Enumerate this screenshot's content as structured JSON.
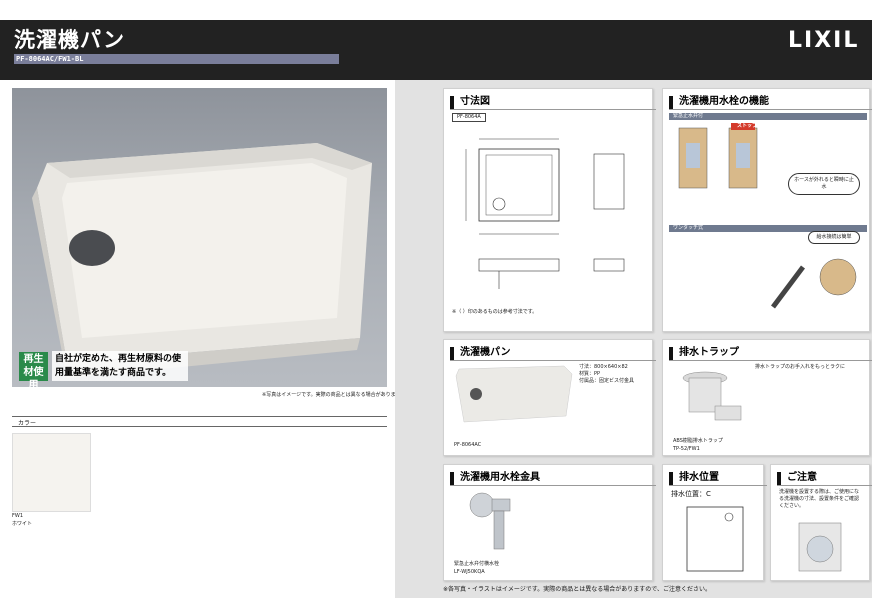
{
  "header": {
    "title": "洗濯機パン",
    "product_code": "PF-8064AC/FW1-BL",
    "brand": "LIXIL"
  },
  "photo": {
    "note": "※写真はイメージです。実際の商品とは異なる場合があります。"
  },
  "badge": {
    "label": "再生材使用",
    "text": "自社が定めた、再生材原料の使用量基準を満たす商品です。"
  },
  "color_section": {
    "heading": "カラー",
    "swatch_code": "FW1",
    "swatch_name": "ホワイト"
  },
  "panels": {
    "dimensions": {
      "title": "寸法図",
      "model": "PF-8064A",
      "footnote": "※（ ）印のあるものは参考寸法です。"
    },
    "faucet_function": {
      "title": "洗濯機用水栓の機能",
      "sub1": "緊急止水弁付",
      "sub2": "ワンタッチ式",
      "stop_label": "ストップ",
      "callout1": "ホースが外れると瞬時に止水",
      "callout2": "給水接続は簡単"
    },
    "pan": {
      "title": "洗濯機パン",
      "size": "寸法：800×640×82",
      "material": "材質：PP",
      "accessories": "付属品：固定ビス付金具",
      "caption": "PF-8064AC"
    },
    "trap": {
      "title": "排水トラップ",
      "text": "排水トラップのお手入れをもっとラクに",
      "caption": "ABS樹脂排水トラップ",
      "model": "TP-52/FW1"
    },
    "faucet_fitting": {
      "title": "洗濯機用水栓金具",
      "caption": "緊急止水弁付横水栓",
      "model": "LF-WJ50KQA"
    },
    "drain_position": {
      "title": "排水位置",
      "value": "排水位置：C"
    },
    "caution": {
      "title": "ご注意",
      "text": "洗濯機を設置する際は、ご使用になる洗濯機の寸法、設置条件をご確認ください。"
    }
  },
  "footnote": "※各写真・イラストはイメージです。実際の商品とは異なる場合がありますので、ご注意ください。"
}
